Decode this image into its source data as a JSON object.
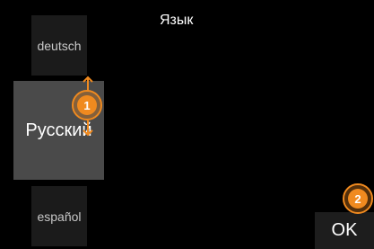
{
  "screen": {
    "title": "Язык",
    "languages": [
      {
        "label": "deutsch",
        "selected": false
      },
      {
        "label": "Русский",
        "selected": true
      },
      {
        "label": "español",
        "selected": false
      }
    ],
    "ok_label": "OK"
  },
  "annotations": {
    "step_1": "1",
    "step_2": "2",
    "accent_color": "#f08a1f"
  },
  "icons": {
    "scroll_up": "arrow-up-icon",
    "scroll_down": "arrow-down-icon"
  }
}
